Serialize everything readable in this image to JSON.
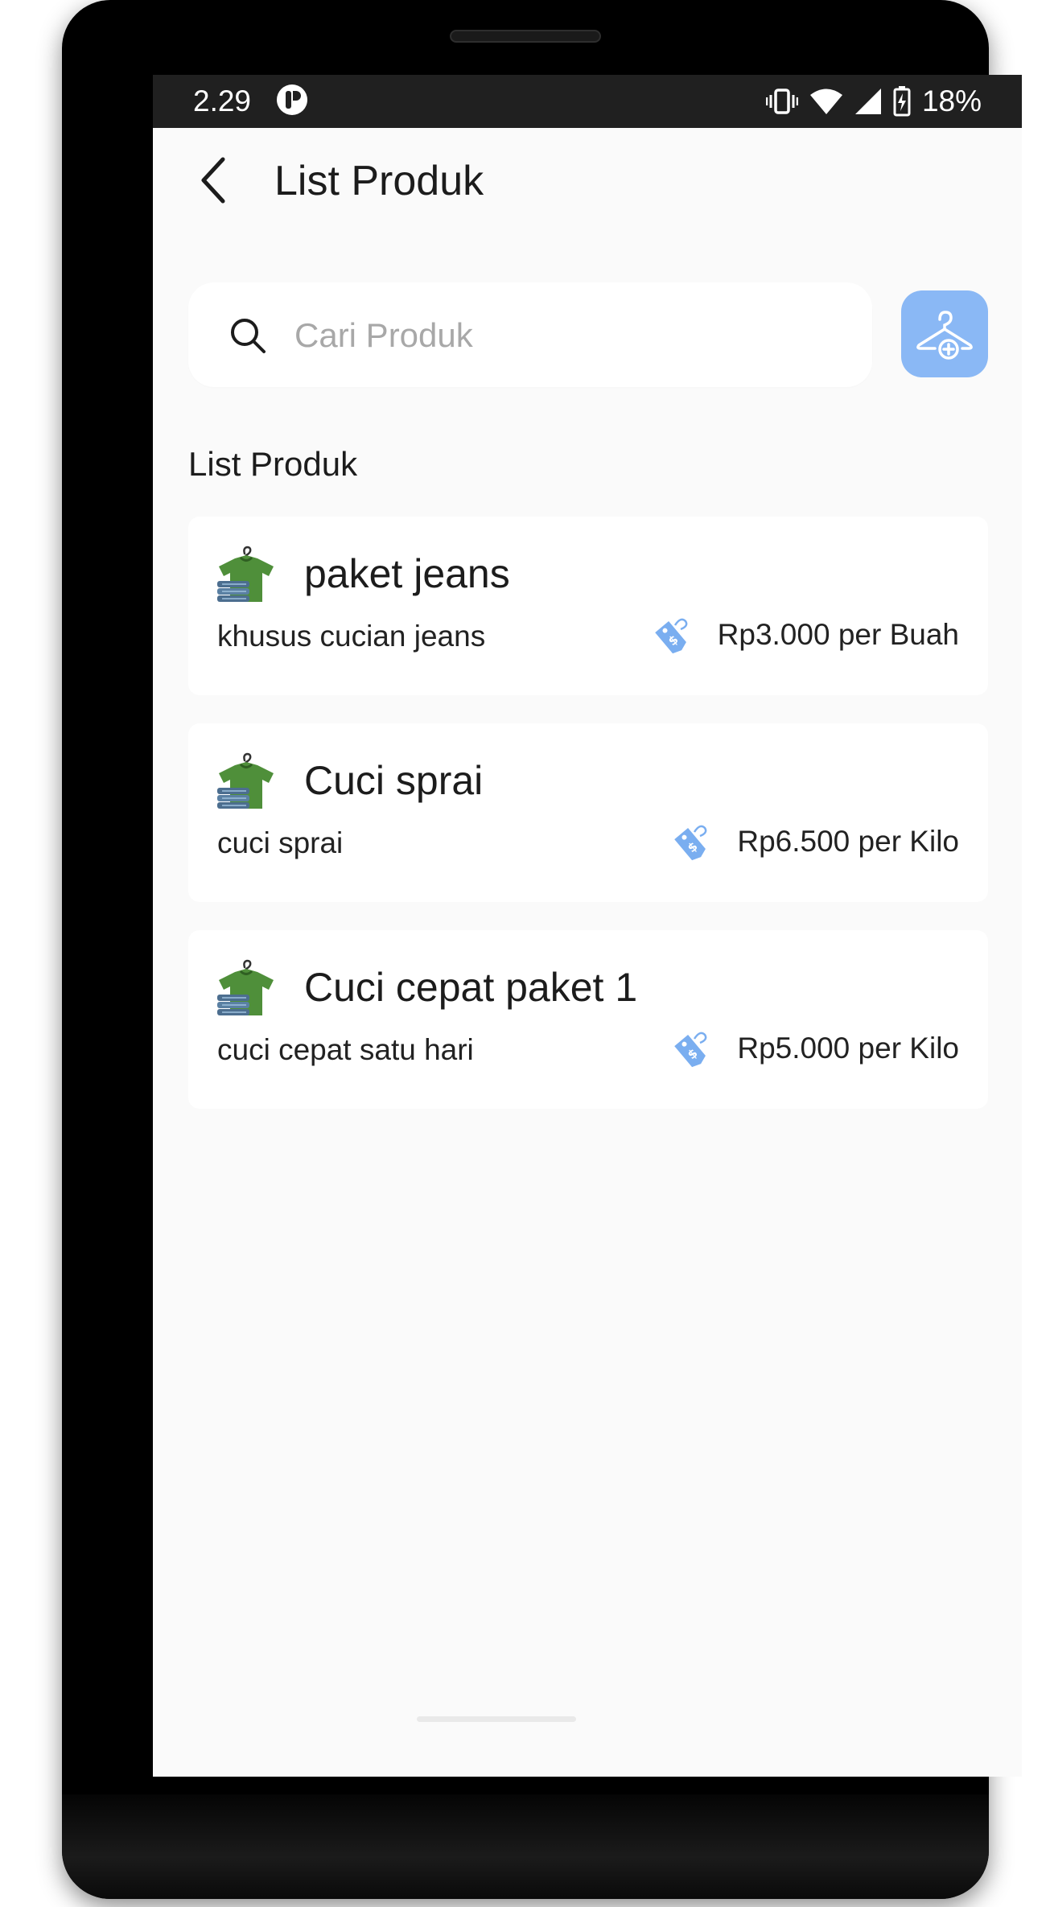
{
  "status_bar": {
    "time": "2.29",
    "battery": "18%"
  },
  "header": {
    "title": "List Produk"
  },
  "search": {
    "placeholder": "Cari Produk"
  },
  "section": {
    "title": "List Produk"
  },
  "products": [
    {
      "name": "paket jeans",
      "description": "khusus cucian jeans",
      "price": "Rp3.000 per Buah"
    },
    {
      "name": "Cuci sprai",
      "description": "cuci sprai",
      "price": "Rp6.500 per Kilo"
    },
    {
      "name": "Cuci cepat paket 1",
      "description": "cuci cepat satu hari",
      "price": "Rp5.000 per Kilo"
    }
  ],
  "icons": {
    "back": "back-arrow-icon",
    "search": "search-icon",
    "add_product": "hanger-add-icon",
    "product": "shirt-stack-icon",
    "price": "price-tag-icon"
  },
  "colors": {
    "accent": "#8ab8f5",
    "price_tag": "#7aaef0",
    "shirt_green": "#4f8f3a",
    "screen_bg": "#fafafa",
    "status_bar_bg": "#202020"
  }
}
